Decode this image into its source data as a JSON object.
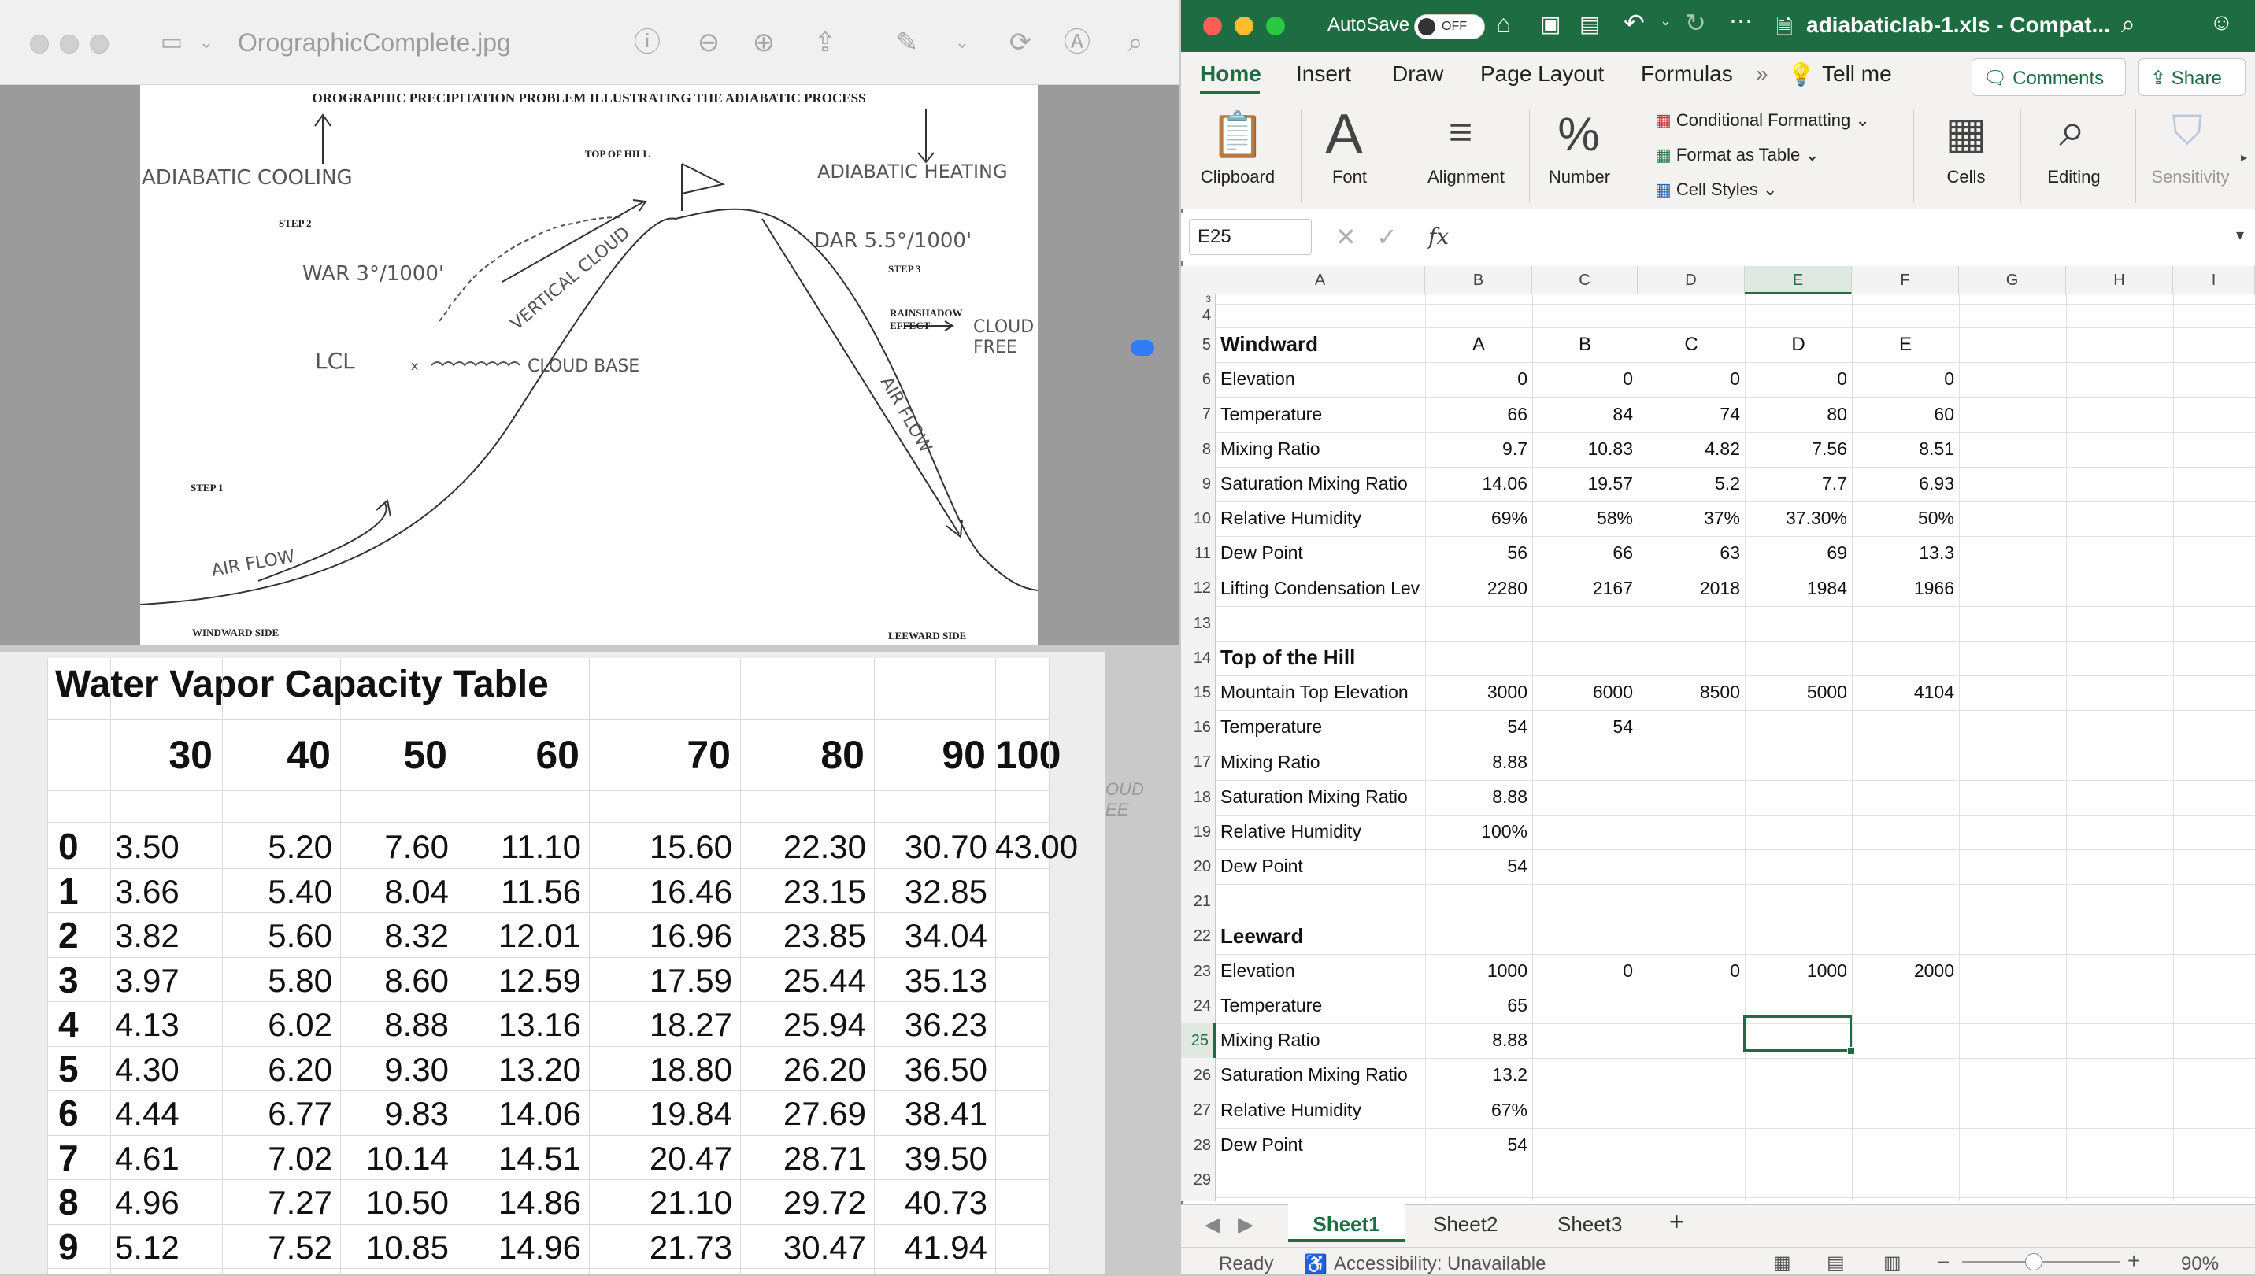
{
  "preview": {
    "filename": "OrographicComplete.jpg",
    "drawing": {
      "title": "OROGRAPHIC PRECIPITATION PROBLEM ILLUSTRATING THE ADIABATIC PROCESS",
      "top_of_hill": "TOP OF HILL",
      "adiabatic_cooling": "ADIABATIC COOLING",
      "adiabatic_heating": "ADIABATIC HEATING",
      "step1": "STEP 1",
      "step2": "STEP 2",
      "step3": "STEP 3",
      "war": "WAR 3°/1000'",
      "dar": "DAR 5.5°/1000'",
      "lcl": "LCL",
      "vertical_cloud": "VERTICAL CLOUD",
      "cloud_base": "CLOUD BASE",
      "rainshadow": "RAINSHADOW",
      "effect": "EFFECT",
      "cloud_free_1": "CLOUD",
      "cloud_free_2": "FREE",
      "air_flow": "AIR FLOW",
      "windward_side": "WINDWARD SIDE",
      "leeward_side": "LEEWARD SIDE",
      "x_mark": "x"
    }
  },
  "water_vapor": {
    "title": "Water Vapor Capacity Table",
    "columns": [
      "30",
      "40",
      "50",
      "60",
      "70",
      "80",
      "90",
      "100"
    ],
    "rows": [
      {
        "label": "0",
        "values": [
          "3.50",
          "5.20",
          "7.60",
          "11.10",
          "15.60",
          "22.30",
          "30.70",
          "43.00"
        ]
      },
      {
        "label": "1",
        "values": [
          "3.66",
          "5.40",
          "8.04",
          "11.56",
          "16.46",
          "23.15",
          "32.85",
          ""
        ]
      },
      {
        "label": "2",
        "values": [
          "3.82",
          "5.60",
          "8.32",
          "12.01",
          "16.96",
          "23.85",
          "34.04",
          ""
        ]
      },
      {
        "label": "3",
        "values": [
          "3.97",
          "5.80",
          "8.60",
          "12.59",
          "17.59",
          "25.44",
          "35.13",
          ""
        ]
      },
      {
        "label": "4",
        "values": [
          "4.13",
          "6.02",
          "8.88",
          "13.16",
          "18.27",
          "25.94",
          "36.23",
          ""
        ]
      },
      {
        "label": "5",
        "values": [
          "4.30",
          "6.20",
          "9.30",
          "13.20",
          "18.80",
          "26.20",
          "36.50",
          ""
        ]
      },
      {
        "label": "6",
        "values": [
          "4.44",
          "6.77",
          "9.83",
          "14.06",
          "19.84",
          "27.69",
          "38.41",
          ""
        ]
      },
      {
        "label": "7",
        "values": [
          "4.61",
          "7.02",
          "10.14",
          "14.51",
          "20.47",
          "28.71",
          "39.50",
          ""
        ]
      },
      {
        "label": "8",
        "values": [
          "4.96",
          "7.27",
          "10.50",
          "14.86",
          "21.10",
          "29.72",
          "40.73",
          ""
        ]
      },
      {
        "label": "9",
        "values": [
          "5.12",
          "7.52",
          "10.85",
          "14.96",
          "21.73",
          "30.47",
          "41.94",
          ""
        ]
      }
    ],
    "ghost_1": "OUD",
    "ghost_2": "EE"
  },
  "excel": {
    "autosave_label": "AutoSave",
    "autosave_state": "OFF",
    "document_title": "adiabaticlab-1.xls - Compat...",
    "ribbon_tabs": [
      "Home",
      "Insert",
      "Draw",
      "Page Layout",
      "Formulas",
      "Tell me"
    ],
    "comments_label": "Comments",
    "share_label": "Share",
    "groups": {
      "clipboard": "Clipboard",
      "font": "Font",
      "alignment": "Alignment",
      "number": "Number",
      "conditional_formatting": "Conditional Formatting",
      "format_as_table": "Format as Table",
      "cell_styles": "Cell Styles",
      "cells": "Cells",
      "editing": "Editing",
      "sensitivity": "Sensitivity"
    },
    "name_box": "E25",
    "fx": "fx",
    "column_headers": [
      "A",
      "B",
      "C",
      "D",
      "E",
      "F",
      "G",
      "H",
      "I"
    ],
    "rows": [
      {
        "n": "3",
        "cells": [
          "",
          "",
          "",
          "",
          "",
          ""
        ]
      },
      {
        "n": "4",
        "cells": [
          "",
          "",
          "",
          "",
          "",
          ""
        ]
      },
      {
        "n": "5",
        "cells": [
          "Windward",
          "A",
          "B",
          "C",
          "D",
          "E"
        ],
        "bold": true,
        "center": true
      },
      {
        "n": "6",
        "cells": [
          "Elevation",
          "0",
          "0",
          "0",
          "0",
          "0"
        ]
      },
      {
        "n": "7",
        "cells": [
          "Temperature",
          "66",
          "84",
          "74",
          "80",
          "60"
        ]
      },
      {
        "n": "8",
        "cells": [
          "Mixing Ratio",
          "9.7",
          "10.83",
          "4.82",
          "7.56",
          "8.51"
        ]
      },
      {
        "n": "9",
        "cells": [
          "Saturation Mixing Ratio",
          "14.06",
          "19.57",
          "5.2",
          "7.7",
          "6.93"
        ]
      },
      {
        "n": "10",
        "cells": [
          "Relative Humidity",
          "69%",
          "58%",
          "37%",
          "37.30%",
          "50%"
        ]
      },
      {
        "n": "11",
        "cells": [
          "Dew Point",
          "56",
          "66",
          "63",
          "69",
          "13.3"
        ]
      },
      {
        "n": "12",
        "cells": [
          "Lifting Condensation Level",
          "2280",
          "2167",
          "2018",
          "1984",
          "1966"
        ]
      },
      {
        "n": "13",
        "cells": [
          "",
          "",
          "",
          "",
          "",
          ""
        ]
      },
      {
        "n": "14",
        "cells": [
          "Top of the Hill",
          "",
          "",
          "",
          "",
          ""
        ],
        "bold": true
      },
      {
        "n": "15",
        "cells": [
          "Mountain Top Elevation",
          "3000",
          "6000",
          "8500",
          "5000",
          "4104"
        ]
      },
      {
        "n": "16",
        "cells": [
          "Temperature",
          "54",
          "54",
          "",
          "",
          ""
        ]
      },
      {
        "n": "17",
        "cells": [
          "Mixing Ratio",
          "8.88",
          "",
          "",
          "",
          ""
        ]
      },
      {
        "n": "18",
        "cells": [
          "Saturation Mixing Ratio",
          "8.88",
          "",
          "",
          "",
          ""
        ]
      },
      {
        "n": "19",
        "cells": [
          "Relative Humidity",
          "100%",
          "",
          "",
          "",
          ""
        ]
      },
      {
        "n": "20",
        "cells": [
          "Dew Point",
          "54",
          "",
          "",
          "",
          ""
        ]
      },
      {
        "n": "21",
        "cells": [
          "",
          "",
          "",
          "",
          "",
          ""
        ]
      },
      {
        "n": "22",
        "cells": [
          "Leeward",
          "",
          "",
          "",
          "",
          ""
        ],
        "bold": true
      },
      {
        "n": "23",
        "cells": [
          "Elevation",
          "1000",
          "0",
          "0",
          "1000",
          "2000"
        ]
      },
      {
        "n": "24",
        "cells": [
          "Temperature",
          "65",
          "",
          "",
          "",
          ""
        ]
      },
      {
        "n": "25",
        "cells": [
          "Mixing Ratio",
          "8.88",
          "",
          "",
          "",
          ""
        ]
      },
      {
        "n": "26",
        "cells": [
          "Saturation Mixing Ratio",
          "13.2",
          "",
          "",
          "",
          ""
        ]
      },
      {
        "n": "27",
        "cells": [
          "Relative Humidity",
          "67%",
          "",
          "",
          "",
          ""
        ]
      },
      {
        "n": "28",
        "cells": [
          "Dew Point",
          "54",
          "",
          "",
          "",
          ""
        ]
      },
      {
        "n": "29",
        "cells": [
          "",
          "",
          "",
          "",
          "",
          ""
        ]
      }
    ],
    "sheet_tabs": [
      "Sheet1",
      "Sheet2",
      "Sheet3"
    ],
    "status_ready": "Ready",
    "status_accessibility": "Accessibility: Unavailable",
    "zoom": "90%"
  }
}
